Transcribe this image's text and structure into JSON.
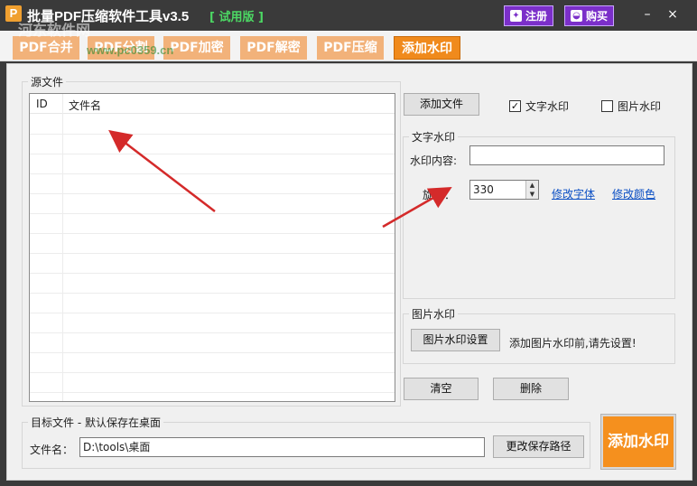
{
  "window": {
    "app_logo": "P",
    "title": "批量PDF压缩软件工具v3.5",
    "trial": "[ 试用版 ]",
    "register_label": "注册",
    "buy_label": "购买",
    "minimize": "–",
    "close": "×"
  },
  "tabs": [
    {
      "label": "PDF合并"
    },
    {
      "label": "PDF分割"
    },
    {
      "label": "PDF加密"
    },
    {
      "label": "PDF解密"
    },
    {
      "label": "PDF压缩"
    },
    {
      "label": "添加水印"
    }
  ],
  "source": {
    "group_title": "源文件",
    "columns": [
      "ID",
      "文件名"
    ],
    "rows": []
  },
  "actions": {
    "add_file": "添加文件",
    "clear": "清空",
    "delete": "删除"
  },
  "watermark_type": {
    "text_label": "文字水印",
    "text_checked": true,
    "image_label": "图片水印",
    "image_checked": false
  },
  "text_watermark": {
    "group_title": "文字水印",
    "content_label": "水印内容:",
    "content_value": "",
    "rotate_label": "旋转：",
    "rotate_value": "330",
    "font_link": "修改字体",
    "color_link": "修改颜色"
  },
  "image_watermark": {
    "group_title": "图片水印",
    "settings_button": "图片水印设置",
    "hint": "添加图片水印前,请先设置!"
  },
  "target": {
    "group_title": "目标文件 - 默认保存在桌面",
    "filename_label": "文件名：",
    "filename_value": "D:\\tools\\桌面",
    "change_path": "更改保存路径"
  },
  "run_button": "添加水印",
  "overlay": {
    "watermark_text": "河东软件网",
    "watermark_url": "www.pc0359.cn"
  },
  "colors": {
    "accent": "#f5901e",
    "tab_inactive": "#f2b27a",
    "titlebar": "#3a3a3a",
    "top_button": "#7b2fc9",
    "arrow": "#d42a2a",
    "link": "#0b4fc4"
  }
}
